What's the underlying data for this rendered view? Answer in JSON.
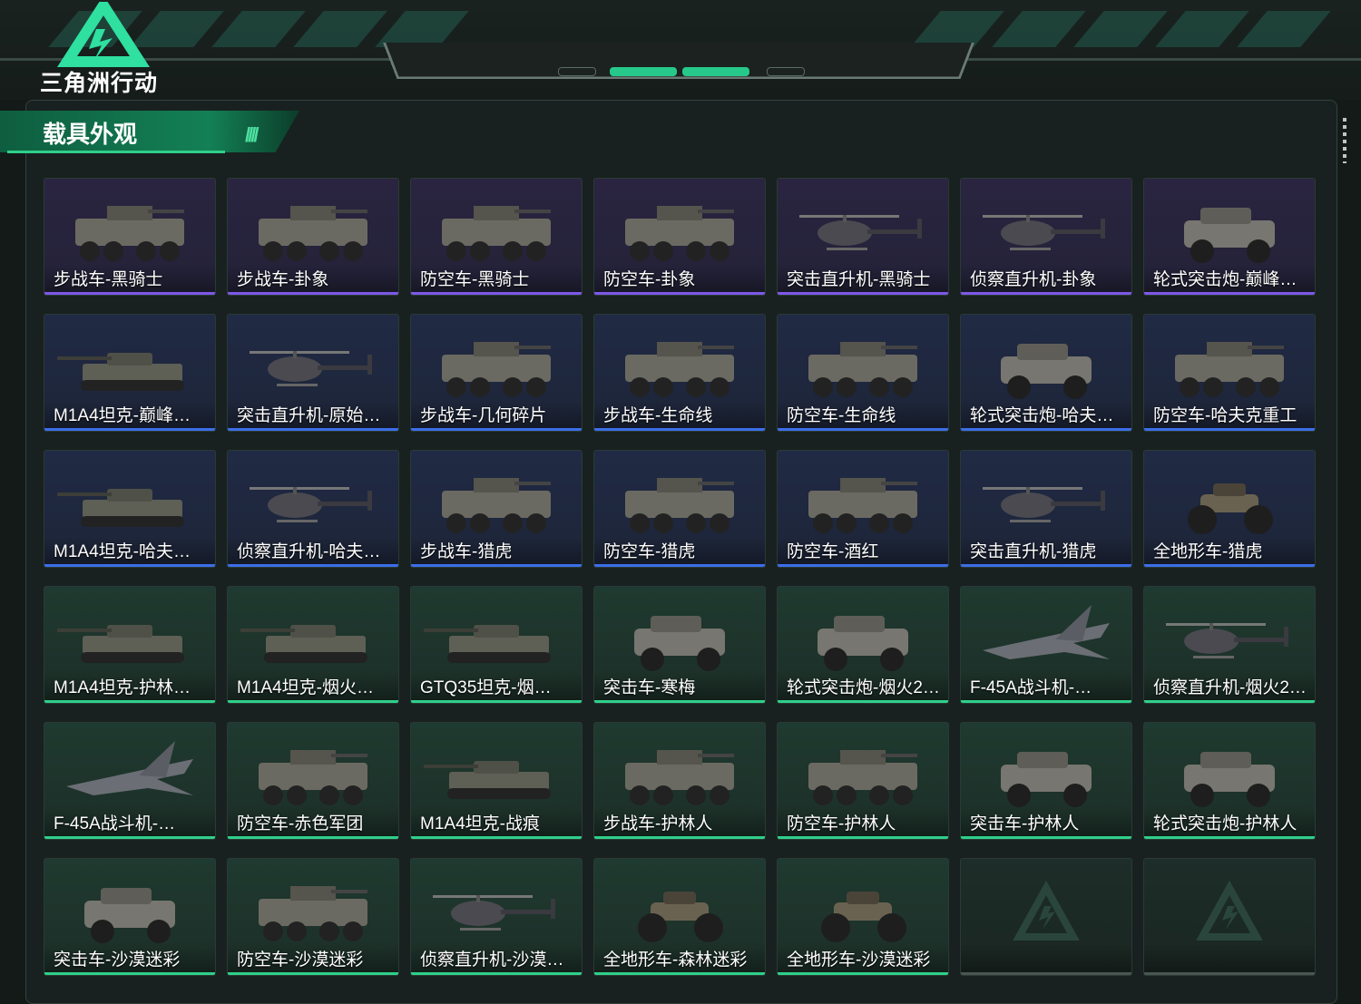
{
  "header": {
    "game_title": "三角洲行动"
  },
  "section": {
    "title": "载具外观"
  },
  "colors": {
    "purple_rarity": "#7d58e8",
    "blue_rarity": "#3c6ee8",
    "green_rarity": "#2fd08a",
    "accent": "#27c98a"
  },
  "cards": [
    {
      "label": "步战车-黑骑士",
      "rarity": "purple",
      "kind": "ifv"
    },
    {
      "label": "步战车-卦象",
      "rarity": "purple",
      "kind": "ifv"
    },
    {
      "label": "防空车-黑骑士",
      "rarity": "purple",
      "kind": "ifv"
    },
    {
      "label": "防空车-卦象",
      "rarity": "purple",
      "kind": "ifv"
    },
    {
      "label": "突击直升机-黑骑士",
      "rarity": "purple",
      "kind": "heli"
    },
    {
      "label": "侦察直升机-卦象",
      "rarity": "purple",
      "kind": "heli"
    },
    {
      "label": "轮式突击炮-巅峰竞…",
      "rarity": "purple",
      "kind": "jeep"
    },
    {
      "label": "M1A4坦克-巅峰…",
      "rarity": "blue",
      "kind": "tank"
    },
    {
      "label": "突击直升机-原始伪…",
      "rarity": "blue",
      "kind": "heli"
    },
    {
      "label": "步战车-几何碎片",
      "rarity": "blue",
      "kind": "ifv"
    },
    {
      "label": "步战车-生命线",
      "rarity": "blue",
      "kind": "ifv"
    },
    {
      "label": "防空车-生命线",
      "rarity": "blue",
      "kind": "ifv"
    },
    {
      "label": "轮式突击炮-哈夫克…",
      "rarity": "blue",
      "kind": "jeep"
    },
    {
      "label": "防空车-哈夫克重工",
      "rarity": "blue",
      "kind": "ifv"
    },
    {
      "label": "M1A4坦克-哈夫…",
      "rarity": "blue",
      "kind": "tank"
    },
    {
      "label": "侦察直升机-哈夫克…",
      "rarity": "blue",
      "kind": "heli"
    },
    {
      "label": "步战车-猎虎",
      "rarity": "blue",
      "kind": "ifv"
    },
    {
      "label": "防空车-猎虎",
      "rarity": "blue",
      "kind": "ifv"
    },
    {
      "label": "防空车-酒红",
      "rarity": "blue",
      "kind": "ifv"
    },
    {
      "label": "突击直升机-猎虎",
      "rarity": "blue",
      "kind": "heli"
    },
    {
      "label": "全地形车-猎虎",
      "rarity": "blue",
      "kind": "atv"
    },
    {
      "label": "M1A4坦克-护林…",
      "rarity": "green",
      "kind": "tank"
    },
    {
      "label": "M1A4坦克-烟火…",
      "rarity": "green",
      "kind": "tank"
    },
    {
      "label": "GTQ35坦克-烟…",
      "rarity": "green",
      "kind": "tank"
    },
    {
      "label": "突击车-寒梅",
      "rarity": "green",
      "kind": "jeep"
    },
    {
      "label": "轮式突击炮-烟火2…",
      "rarity": "green",
      "kind": "jeep"
    },
    {
      "label": "F-45A战斗机-…",
      "rarity": "green",
      "kind": "jet"
    },
    {
      "label": "侦察直升机-烟火2…",
      "rarity": "green",
      "kind": "heli"
    },
    {
      "label": "F-45A战斗机-…",
      "rarity": "green",
      "kind": "jet"
    },
    {
      "label": "防空车-赤色军团",
      "rarity": "green",
      "kind": "ifv"
    },
    {
      "label": "M1A4坦克-战痕",
      "rarity": "green",
      "kind": "tank"
    },
    {
      "label": "步战车-护林人",
      "rarity": "green",
      "kind": "ifv"
    },
    {
      "label": "防空车-护林人",
      "rarity": "green",
      "kind": "ifv"
    },
    {
      "label": "突击车-护林人",
      "rarity": "green",
      "kind": "jeep"
    },
    {
      "label": "轮式突击炮-护林人",
      "rarity": "green",
      "kind": "jeep"
    },
    {
      "label": "突击车-沙漠迷彩",
      "rarity": "green",
      "kind": "jeep"
    },
    {
      "label": "防空车-沙漠迷彩",
      "rarity": "green",
      "kind": "ifv"
    },
    {
      "label": "侦察直升机-沙漠迷…",
      "rarity": "green",
      "kind": "heli"
    },
    {
      "label": "全地形车-森林迷彩",
      "rarity": "green",
      "kind": "atv"
    },
    {
      "label": "全地形车-沙漠迷彩",
      "rarity": "green",
      "kind": "atv"
    },
    {
      "label": "",
      "rarity": "empty",
      "kind": "none"
    },
    {
      "label": "",
      "rarity": "empty",
      "kind": "none"
    }
  ]
}
